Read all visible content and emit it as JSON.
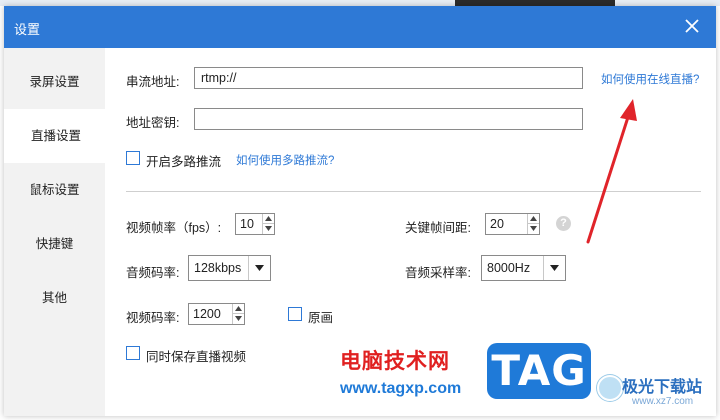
{
  "window": {
    "title": "设置"
  },
  "sidebar": {
    "items": [
      {
        "label": "录屏设置",
        "active": false
      },
      {
        "label": "直播设置",
        "active": true
      },
      {
        "label": "鼠标设置",
        "active": false
      },
      {
        "label": "快捷键",
        "active": false
      },
      {
        "label": "其他",
        "active": false
      }
    ]
  },
  "stream": {
    "url_label": "串流地址:",
    "url_value": "rtmp://",
    "url_help_link": "如何使用在线直播?",
    "key_label": "地址密钥:",
    "key_value": "",
    "multi_label": "开启多路推流",
    "multi_checked": false,
    "multi_help_link": "如何使用多路推流?"
  },
  "video": {
    "fps_label": "视频帧率（fps）:",
    "fps_value": "10",
    "keyframe_label": "关键帧间距:",
    "keyframe_value": "20",
    "keyframe_help": "?",
    "audio_bitrate_label": "音频码率:",
    "audio_bitrate_value": "128kbps",
    "sample_rate_label": "音频采样率:",
    "sample_rate_value": "8000Hz",
    "video_bitrate_label": "视频码率:",
    "video_bitrate_value": "1200",
    "original_label": "原画",
    "original_checked": false,
    "save_label": "同时保存直播视频",
    "save_checked": false
  },
  "watermark": {
    "text": "电脑技术网",
    "url": "www.tagxp.com",
    "tag": "TAG",
    "logo_text": "极光下载站",
    "logo_url": "www.xz7.com"
  },
  "colors": {
    "accent": "#2e79d6",
    "annotation_arrow": "#e0242a"
  }
}
